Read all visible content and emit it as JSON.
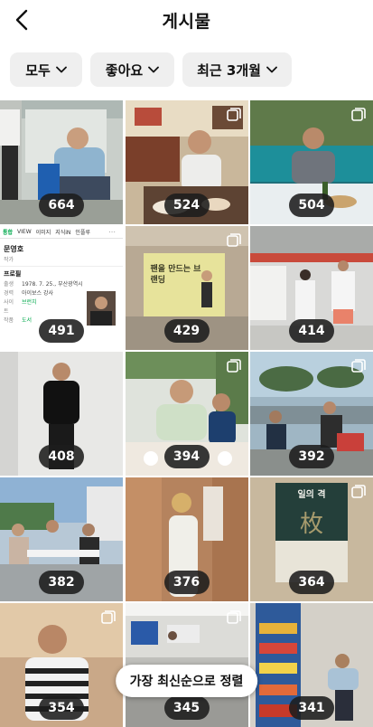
{
  "header": {
    "title": "게시물"
  },
  "filters": [
    {
      "label": "모두"
    },
    {
      "label": "좋아요"
    },
    {
      "label": "최근 3개월"
    }
  ],
  "posts": [
    {
      "count": "664",
      "multi": false
    },
    {
      "count": "524",
      "multi": true
    },
    {
      "count": "504",
      "multi": true
    },
    {
      "count": "491",
      "multi": true
    },
    {
      "count": "429",
      "multi": true
    },
    {
      "count": "414",
      "multi": false
    },
    {
      "count": "408",
      "multi": false
    },
    {
      "count": "394",
      "multi": true
    },
    {
      "count": "392",
      "multi": true
    },
    {
      "count": "382",
      "multi": false
    },
    {
      "count": "376",
      "multi": false
    },
    {
      "count": "364",
      "multi": true
    },
    {
      "count": "354",
      "multi": true
    },
    {
      "count": "345",
      "multi": true
    },
    {
      "count": "341",
      "multi": false
    }
  ],
  "screenshot_post": {
    "tabs": [
      "통합",
      "VIEW",
      "이미지",
      "지식iN",
      "인플루"
    ],
    "name": "문영호",
    "role": "작가",
    "section": "프로필",
    "rows": [
      {
        "k": "출생",
        "v": "1978. 7. 25., 부산광역시"
      },
      {
        "k": "경력",
        "v": "아이보스 강사"
      },
      {
        "k": "사이트",
        "v": "브런치"
      },
      {
        "k": "작품",
        "v": "도서"
      }
    ]
  },
  "poster_post": {
    "headline": "팬을 만드는 브랜딩"
  },
  "book_post": {
    "title": "일의 격"
  },
  "sort_button": {
    "label": "가장 최신순으로 정렬"
  }
}
